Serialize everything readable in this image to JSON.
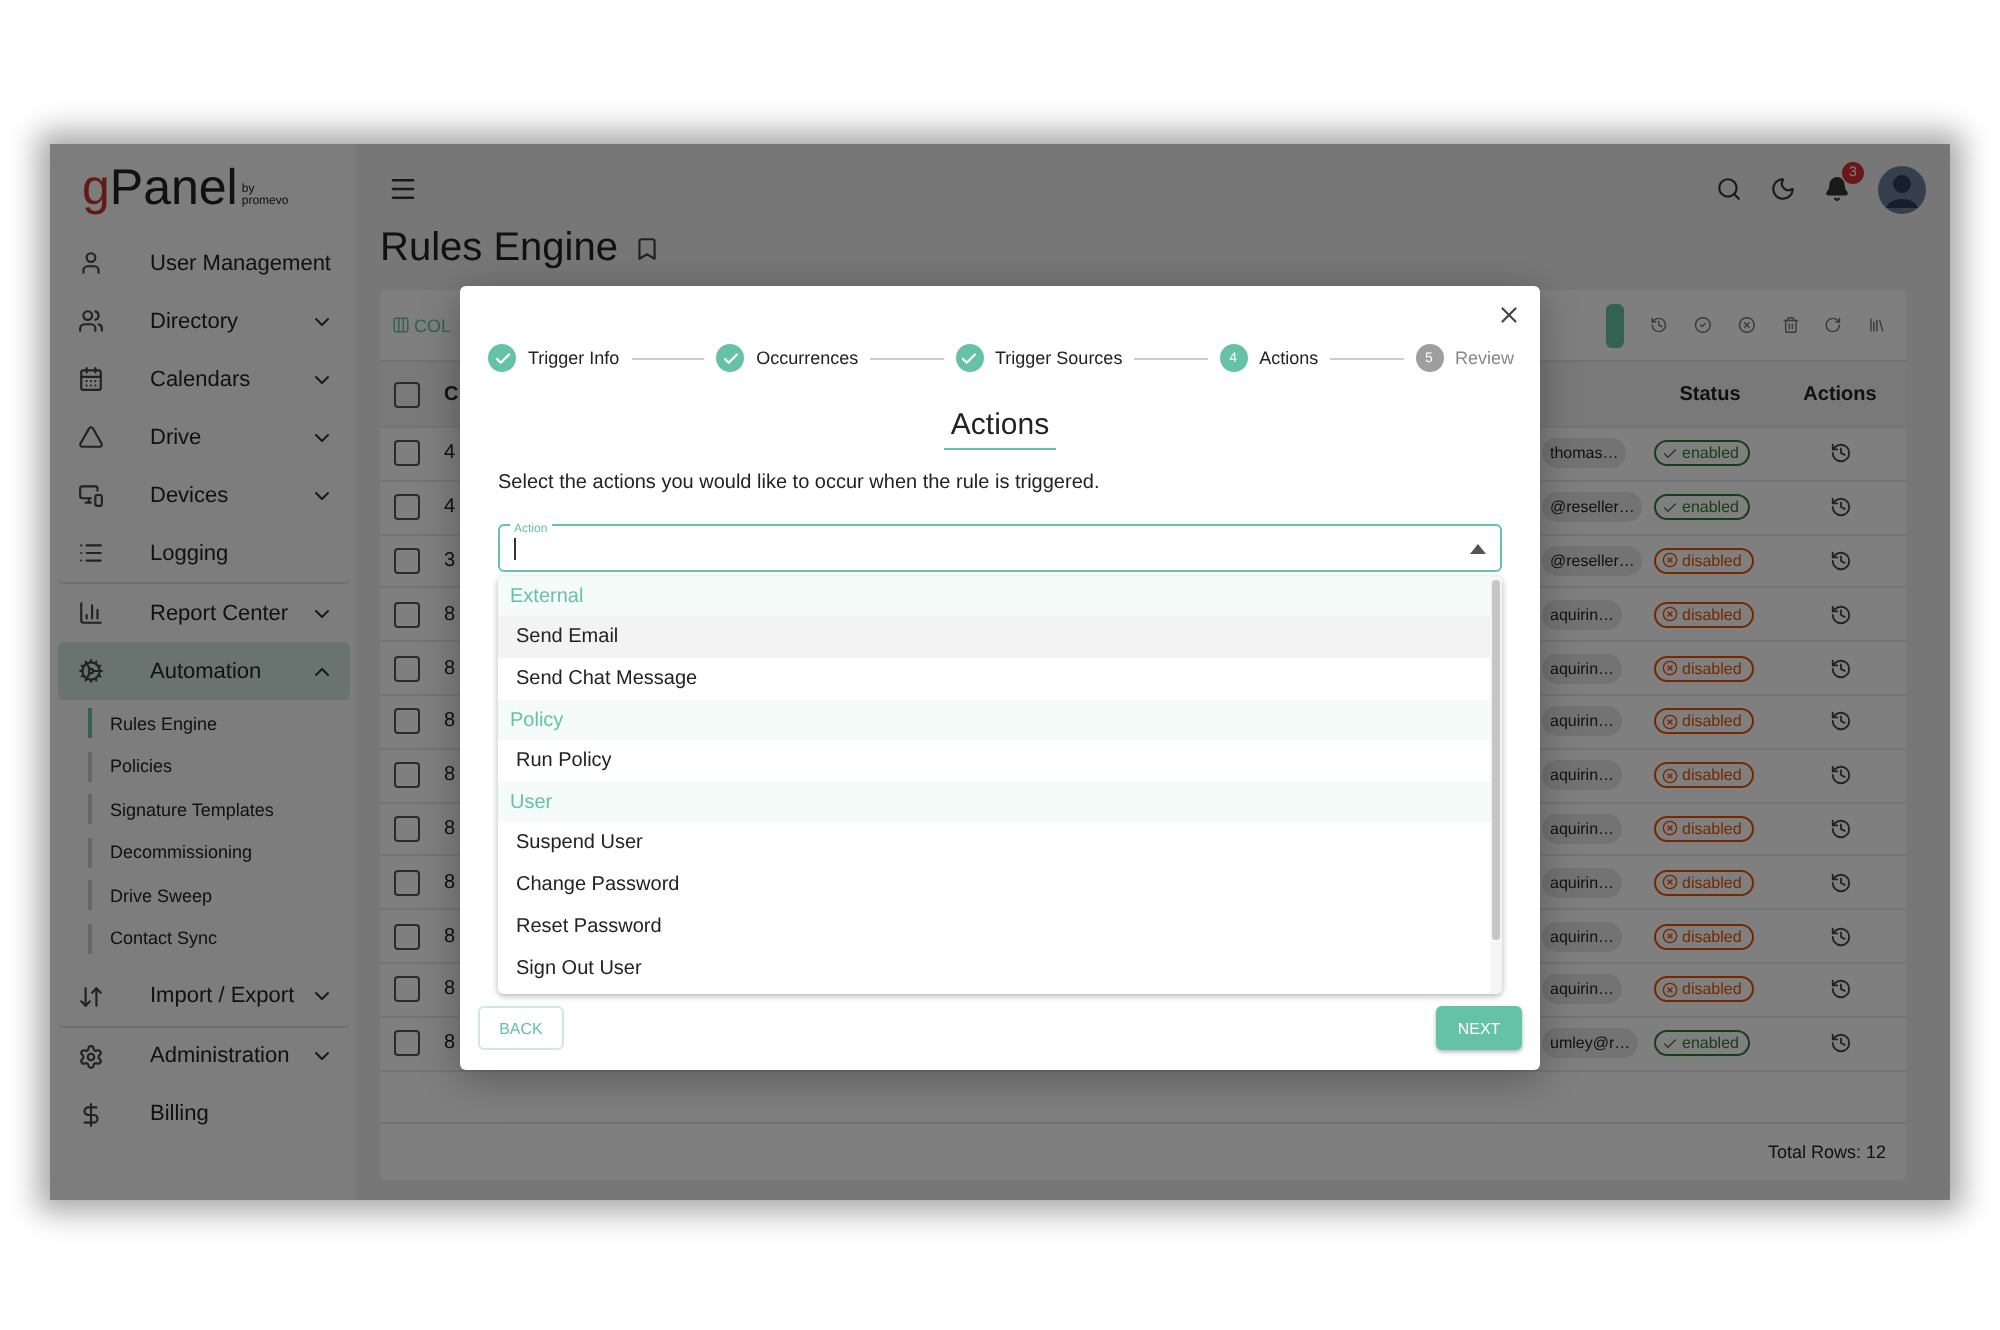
{
  "logo": {
    "mark": "g",
    "name": "Panel",
    "by": "by",
    "maker": "promevo"
  },
  "sidebar": {
    "items": [
      {
        "label": "User Management"
      },
      {
        "label": "Directory",
        "expanded": false
      },
      {
        "label": "Calendars",
        "expanded": false
      },
      {
        "label": "Drive",
        "expanded": false
      },
      {
        "label": "Devices",
        "expanded": false
      },
      {
        "label": "Logging"
      },
      {
        "label": "Report Center",
        "expanded": false
      },
      {
        "label": "Automation",
        "expanded": true,
        "selected": true,
        "children": [
          {
            "label": "Rules Engine",
            "selected": true
          },
          {
            "label": "Policies",
            "selected": false
          },
          {
            "label": "Signature Templates",
            "selected": false
          },
          {
            "label": "Decommissioning",
            "selected": false
          },
          {
            "label": "Drive Sweep",
            "selected": false
          },
          {
            "label": "Contact Sync",
            "selected": false
          }
        ]
      },
      {
        "label": "Import / Export",
        "expanded": false
      },
      {
        "label": "Administration",
        "expanded": false
      },
      {
        "label": "Billing"
      }
    ]
  },
  "topbar": {
    "notification_count": "3"
  },
  "page": {
    "title": "Rules Engine"
  },
  "table": {
    "toolbar": {
      "columns_button": "COL"
    },
    "select_all": false,
    "columns": [
      {
        "label": "C"
      },
      {
        "label": "Status"
      },
      {
        "label": "Actions"
      }
    ],
    "rows": [
      {
        "checked": false,
        "column_1": "4",
        "owner": "thomas…",
        "status": "enabled",
        "enabled": true
      },
      {
        "checked": false,
        "column_1": "4",
        "owner": "@reseller…",
        "status": "enabled",
        "enabled": true
      },
      {
        "checked": false,
        "column_1": "3",
        "owner": "@reseller…",
        "status": "disabled",
        "enabled": false
      },
      {
        "checked": false,
        "column_1": "8",
        "owner": "aquirin…",
        "status": "disabled",
        "enabled": false
      },
      {
        "checked": false,
        "column_1": "8",
        "owner": "aquirin…",
        "status": "disabled",
        "enabled": false
      },
      {
        "checked": false,
        "column_1": "8",
        "owner": "aquirin…",
        "status": "disabled",
        "enabled": false
      },
      {
        "checked": false,
        "column_1": "8",
        "owner": "aquirin…",
        "status": "disabled",
        "enabled": false
      },
      {
        "checked": false,
        "column_1": "8",
        "owner": "aquirin…",
        "status": "disabled",
        "enabled": false
      },
      {
        "checked": false,
        "column_1": "8",
        "owner": "aquirin…",
        "status": "disabled",
        "enabled": false
      },
      {
        "checked": false,
        "column_1": "8",
        "owner": "aquirin…",
        "status": "disabled",
        "enabled": false
      },
      {
        "checked": false,
        "column_1": "8",
        "owner": "aquirin…",
        "status": "disabled",
        "enabled": false
      },
      {
        "checked": false,
        "column_1": "8",
        "owner": "umley@r…",
        "status": "enabled",
        "enabled": true
      }
    ],
    "footer": "Total Rows: 12"
  },
  "dialog": {
    "steps": [
      {
        "label": "Trigger Info",
        "kind": "done"
      },
      {
        "label": "Occurrences",
        "kind": "done"
      },
      {
        "label": "Trigger Sources",
        "kind": "done"
      },
      {
        "label": "Actions",
        "number": "4",
        "kind": "current"
      },
      {
        "label": "Review",
        "number": "5",
        "kind": "pending"
      }
    ],
    "title": "Actions",
    "description": "Select the actions you would like to occur when the rule is triggered.",
    "field": {
      "label": "Action",
      "open": true
    },
    "groups": [
      {
        "label": "External",
        "options": [
          {
            "label": "Send Email",
            "highlighted": true
          },
          {
            "label": "Send Chat Message",
            "highlighted": false
          }
        ]
      },
      {
        "label": "Policy",
        "options": [
          {
            "label": "Run Policy",
            "highlighted": false
          }
        ]
      },
      {
        "label": "User",
        "options": [
          {
            "label": "Suspend User",
            "highlighted": false
          },
          {
            "label": "Change Password",
            "highlighted": false
          },
          {
            "label": "Reset Password",
            "highlighted": false
          },
          {
            "label": "Sign Out User",
            "highlighted": false
          }
        ]
      }
    ],
    "back_button": "BACK",
    "next_button": "NEXT"
  }
}
